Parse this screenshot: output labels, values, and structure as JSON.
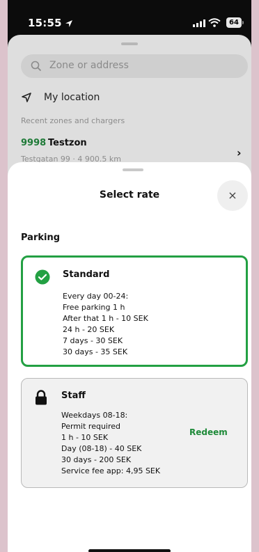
{
  "status_bar": {
    "time": "15:55",
    "battery": "64"
  },
  "background_sheet": {
    "search_placeholder": "Zone or address",
    "my_location": "My location",
    "recent_heading": "Recent zones and chargers",
    "recent_items": [
      {
        "number": "9998",
        "name": "Testzon",
        "subtitle": "Testgatan 99 · 4 900.5 km"
      }
    ]
  },
  "sheet": {
    "title": "Select rate",
    "close_label": "×",
    "section": "Parking",
    "rates": [
      {
        "title": "Standard",
        "selected": true,
        "icon": "check-circle-icon",
        "lines": [
          "Every day 00-24:",
          "Free parking 1 h",
          "After that 1 h - 10 SEK",
          "24 h - 20 SEK",
          "7 days - 30 SEK",
          "30 days - 35 SEK"
        ]
      },
      {
        "title": "Staff",
        "selected": false,
        "icon": "lock-icon",
        "action": "Redeem",
        "lines": [
          "Weekdays 08-18:",
          "Permit required",
          "1 h - 10 SEK",
          "Day (08-18) - 40 SEK",
          "30 days - 200 SEK",
          "Service fee app: 4,95 SEK"
        ]
      }
    ]
  },
  "colors": {
    "accent_green": "#23a043",
    "text": "#111111"
  }
}
